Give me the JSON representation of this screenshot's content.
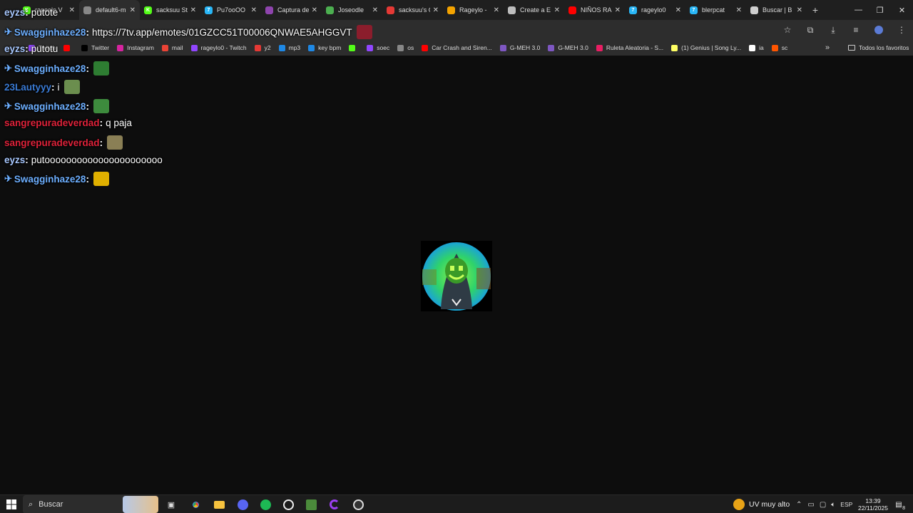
{
  "browser": {
    "tabs": [
      {
        "label": "rageelo V",
        "fav": "K",
        "color": "#53fc18"
      },
      {
        "label": "default6-m",
        "fav": "",
        "color": "#888888"
      },
      {
        "label": "sacksuu St",
        "fav": "K",
        "color": "#53fc18"
      },
      {
        "label": "Pu7ooOO",
        "fav": "7",
        "color": "#29b6f6"
      },
      {
        "label": "Captura de",
        "fav": "",
        "color": "#8e44ad"
      },
      {
        "label": "Joseodle",
        "fav": "",
        "color": "#4caf50"
      },
      {
        "label": "sacksuu's C",
        "fav": "",
        "color": "#e53935"
      },
      {
        "label": "Rageylo -",
        "fav": "",
        "color": "#f4a300"
      },
      {
        "label": "Create a E",
        "fav": "",
        "color": "#bdbdbd"
      },
      {
        "label": "NIÑOS RA",
        "fav": "",
        "color": "#ff0000"
      },
      {
        "label": "rageylo0",
        "fav": "7",
        "color": "#29b6f6"
      },
      {
        "label": "blerpcat",
        "fav": "7",
        "color": "#29b6f6"
      },
      {
        "label": "Buscar | B",
        "fav": "",
        "color": "#cfcfcf"
      }
    ],
    "new_tab": "+",
    "bookmarks": [
      {
        "label": "Twitch",
        "color": "#9146ff"
      },
      {
        "label": "",
        "color": "#ff0000"
      },
      {
        "label": "Twitter",
        "color": "#000000"
      },
      {
        "label": "Instagram",
        "color": "#d6249f"
      },
      {
        "label": "mail",
        "color": "#ea4335"
      },
      {
        "label": "rageylo0 - Twitch",
        "color": "#9146ff"
      },
      {
        "label": "y2",
        "color": "#e53935"
      },
      {
        "label": "mp3",
        "color": "#1e88e5"
      },
      {
        "label": "key bpm",
        "color": "#1e88e5"
      },
      {
        "label": "",
        "color": "#53fc18"
      },
      {
        "label": "soec",
        "color": "#9146ff"
      },
      {
        "label": "os",
        "color": "#888888"
      },
      {
        "label": "Car Crash and Siren...",
        "color": "#ff0000"
      },
      {
        "label": "G-MEH 3.0",
        "color": "#7e57c2"
      },
      {
        "label": "G-MEH 3.0",
        "color": "#7e57c2"
      },
      {
        "label": "Ruleta Aleatoria - S...",
        "color": "#e91e63"
      },
      {
        "label": "(1) Genius | Song Ly...",
        "color": "#ffff64"
      },
      {
        "label": "ia",
        "color": "#ffffff"
      },
      {
        "label": "sc",
        "color": "#ff5500"
      }
    ],
    "bookmarks_more": "»",
    "all_bookmarks": "Todos los favoritos"
  },
  "chat": [
    {
      "user": "eyzs",
      "color": "#a8c8ff",
      "badge": false,
      "text": "putote",
      "emote": null
    },
    {
      "user": "Swagginhaze28",
      "color": "#6dafff",
      "badge": true,
      "text": "https://7tv.app/emotes/01GZCC51T00006QNWAE5AHGGVT",
      "emote": "#8b1d2c"
    },
    {
      "user": "eyzs",
      "color": "#a8c8ff",
      "badge": false,
      "text": "putotu",
      "emote": null
    },
    {
      "user": "Swagginhaze28",
      "color": "#6dafff",
      "badge": true,
      "text": "",
      "emote": "#2e7d32"
    },
    {
      "user": "23Lautyyy",
      "color": "#3a7bd5",
      "badge": false,
      "text": "i",
      "emote": "#6b8e4e"
    },
    {
      "user": "Swagginhaze28",
      "color": "#6dafff",
      "badge": true,
      "text": "",
      "emote": "#3d8b3d"
    },
    {
      "user": "sangrepuradeverdad",
      "color": "#e0223a",
      "badge": false,
      "text": "q paja",
      "emote": null
    },
    {
      "user": "sangrepuradeverdad",
      "color": "#e0223a",
      "badge": false,
      "text": "",
      "emote": "#8a7f55"
    },
    {
      "user": "eyzs",
      "color": "#a8c8ff",
      "badge": false,
      "text": "putoooooooooooooooooooooo",
      "emote": null
    },
    {
      "user": "Swagginhaze28",
      "color": "#6dafff",
      "badge": true,
      "text": "",
      "emote": "#e0b000"
    }
  ],
  "taskbar": {
    "search_placeholder": "Buscar",
    "weather": "UV muy alto",
    "language": "ESP",
    "time": "13:39",
    "date": "22/11/2025",
    "notifications": "8"
  }
}
